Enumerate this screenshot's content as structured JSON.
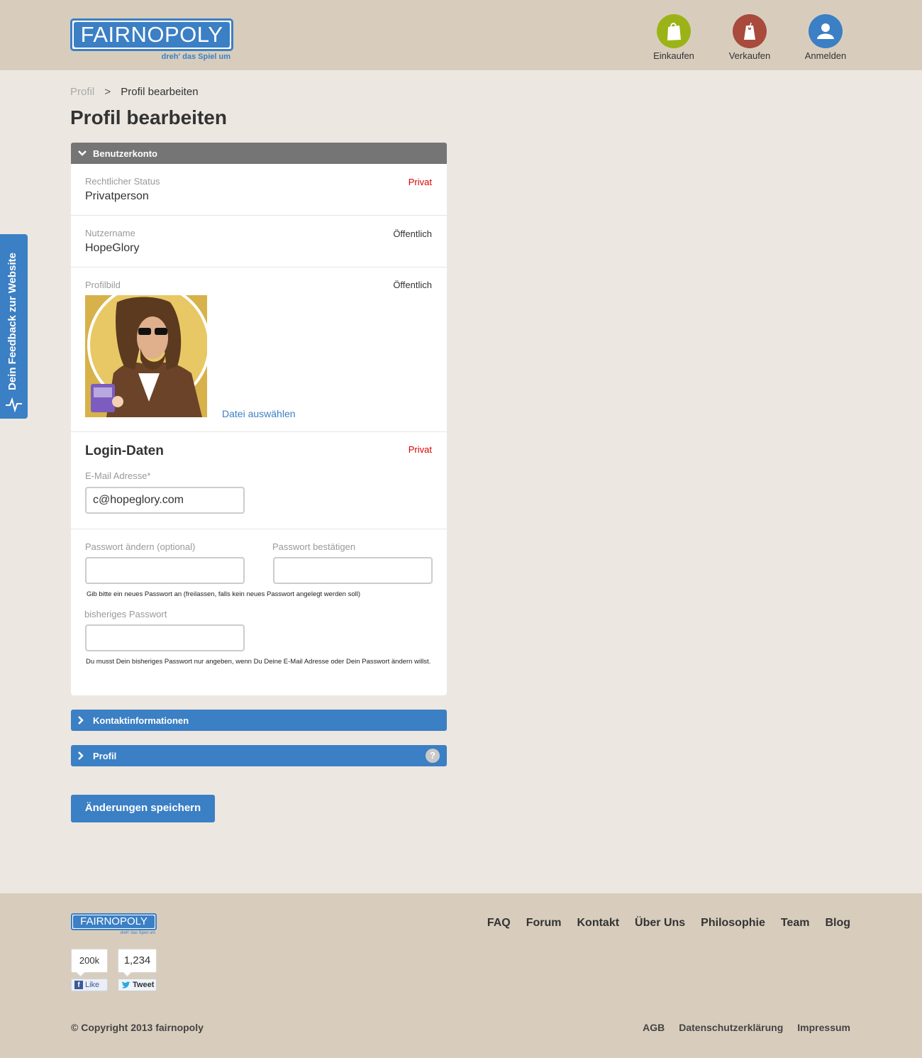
{
  "header": {
    "logo_text": "FAIRNOPOLY",
    "logo_tagline": "dreh' das Spiel um",
    "nav": [
      {
        "label": "Einkaufen",
        "icon": "shopping-bag-icon",
        "color": "#9cb318"
      },
      {
        "label": "Verkaufen",
        "icon": "price-tag-icon",
        "color": "#a84a3c"
      },
      {
        "label": "Anmelden",
        "icon": "user-icon",
        "color": "#3b7fc4"
      }
    ]
  },
  "breadcrumb": {
    "parent": "Profil",
    "separator": ">",
    "current": "Profil bearbeiten"
  },
  "page_title": "Profil bearbeiten",
  "account_panel": {
    "title": "Benutzerkonto",
    "legal_status": {
      "label": "Rechtlicher Status",
      "value": "Privatperson",
      "visibility": "Privat"
    },
    "username": {
      "label": "Nutzername",
      "value": "HopeGlory",
      "visibility": "Öffentlich"
    },
    "profile_image": {
      "label": "Profilbild",
      "visibility": "Öffentlich",
      "choose_file": "Datei auswählen"
    },
    "login": {
      "title": "Login-Daten",
      "visibility": "Privat",
      "email_label": "E-Mail Adresse*",
      "email_value": "c@hopeglory.com",
      "new_password_label": "Passwort ändern (optional)",
      "confirm_password_label": "Passwort bestätigen",
      "password_hint": "Gib bitte ein neues Passwort an (freilassen, falls kein neues Passwort angelegt werden soll)",
      "current_password_label": "bisheriges Passwort",
      "current_password_hint": "Du musst Dein bisheriges Passwort nur angeben, wenn Du Deine E-Mail Adresse oder Dein Passwort ändern willst."
    }
  },
  "contact_panel": {
    "title": "Kontaktinformationen"
  },
  "profile_panel": {
    "title": "Profil",
    "help": "?"
  },
  "save_button": "Änderungen speichern",
  "feedback_tab": "Dein Feedback zur Website",
  "footer": {
    "logo_text": "FAIRNOPOLY",
    "logo_tagline": "dreh' das Spiel um",
    "links": [
      "FAQ",
      "Forum",
      "Kontakt",
      "Über Uns",
      "Philosophie",
      "Team",
      "Blog"
    ],
    "facebook": {
      "count": "200k",
      "label": "Like"
    },
    "twitter": {
      "count": "1,234",
      "label": "Tweet"
    },
    "copyright": "© Copyright 2013 fairnopoly",
    "legal_links": [
      "AGB",
      "Datenschutzerklärung",
      "Impressum"
    ]
  },
  "colors": {
    "brand_blue": "#3b7fc4",
    "private_red": "#dd0000",
    "panel_gray": "#757575"
  }
}
